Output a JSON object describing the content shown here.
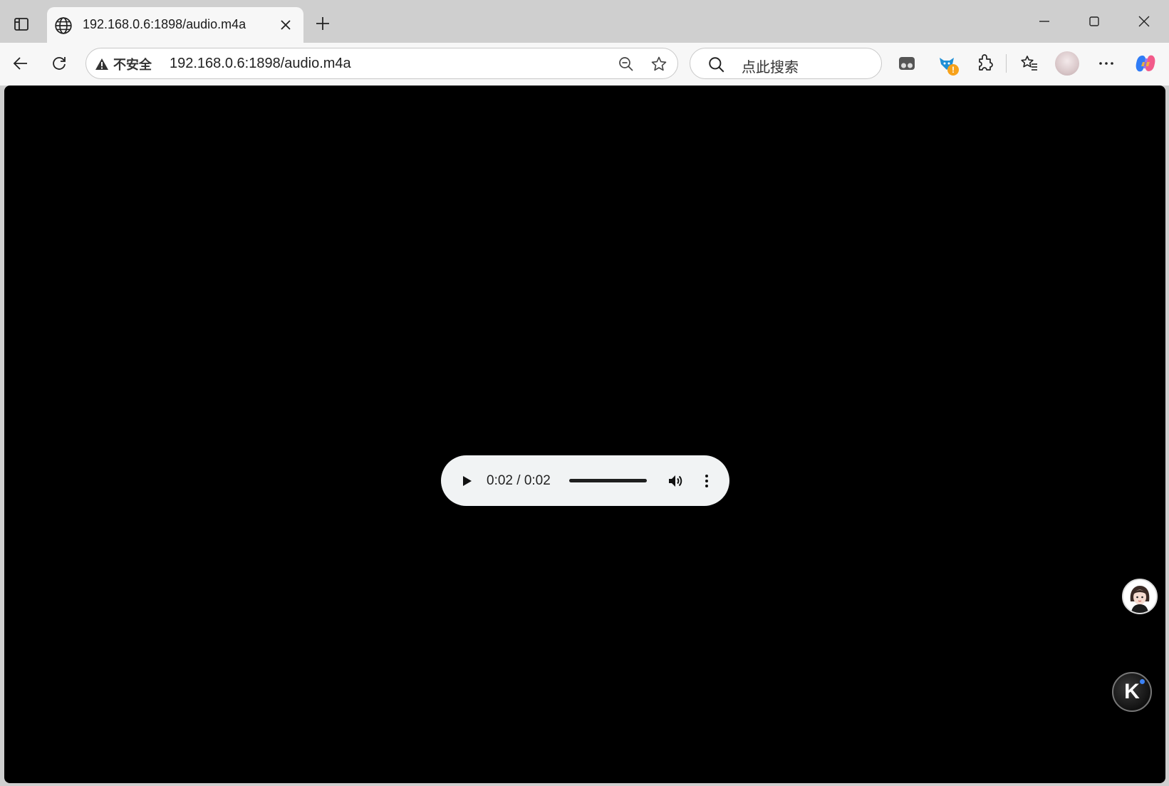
{
  "tab": {
    "title": "192.168.0.6:1898/audio.m4a",
    "favicon": "globe-icon"
  },
  "addressbar": {
    "security_label": "不安全",
    "url": "192.168.0.6:1898/audio.m4a"
  },
  "search": {
    "placeholder": "点此搜索"
  },
  "extension_badge": "!",
  "player": {
    "time": "0:02 / 0:02",
    "progress_fraction": 1.0
  },
  "floating": {
    "k_label": "K"
  },
  "colors": {
    "page_background": "#000000",
    "player_background": "#f1f3f4",
    "badge": "#f7a21b"
  }
}
